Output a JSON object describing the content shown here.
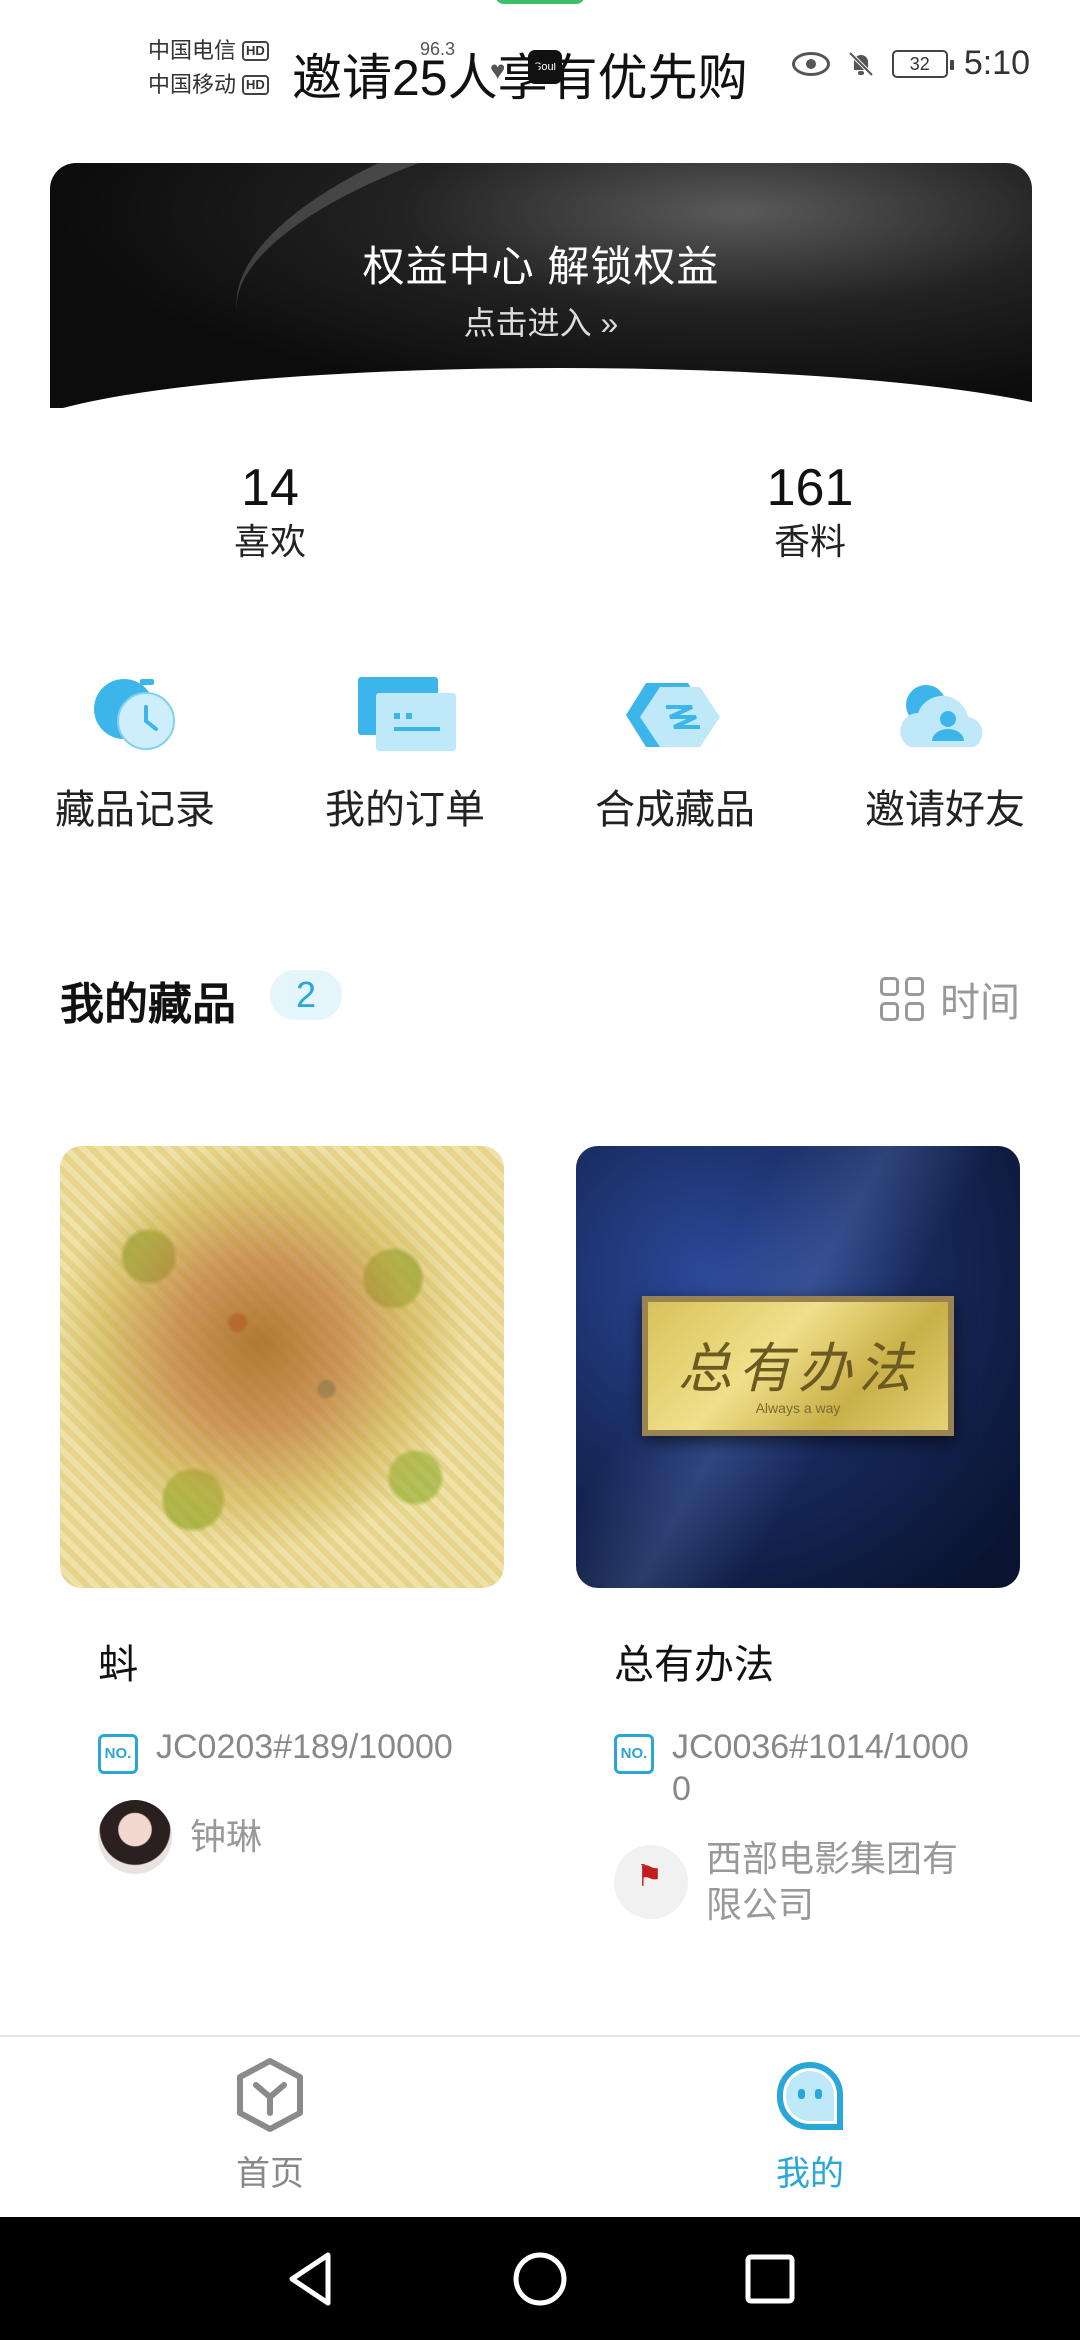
{
  "status_bar": {
    "carrier_1": "中国电信",
    "carrier_2": "中国移动",
    "hd_badge": "HD",
    "net_speed": "96.3",
    "app_badge": "Soul",
    "overlay_text": "邀请25人享有优先购",
    "battery": "32",
    "time": "5:10"
  },
  "banner": {
    "title": "权益中心 解锁权益",
    "subtitle": "点击进入 »"
  },
  "stats": [
    {
      "value": "14",
      "label": "喜欢"
    },
    {
      "value": "161",
      "label": "香料"
    }
  ],
  "actions": [
    {
      "label": "藏品记录",
      "icon": "clock-icon"
    },
    {
      "label": "我的订单",
      "icon": "order-list-icon"
    },
    {
      "label": "合成藏品",
      "icon": "synthesis-icon"
    },
    {
      "label": "邀请好友",
      "icon": "invite-friend-icon"
    }
  ],
  "collection": {
    "title": "我的藏品",
    "count": "2",
    "sort_label": "时间"
  },
  "cards": [
    {
      "name": "蚪",
      "serial": "JC0203#189/10000",
      "owner": "钟琳"
    },
    {
      "name": "总有办法",
      "serial": "JC0036#1014/10000",
      "owner": "西部电影集团有限公司",
      "plaque_text": "总有办法",
      "plaque_sub": "Always a way"
    }
  ],
  "bottom_nav": {
    "home": "首页",
    "mine": "我的"
  },
  "colors": {
    "accent": "#29a7d8",
    "badge_bg": "#e4f5fb"
  }
}
